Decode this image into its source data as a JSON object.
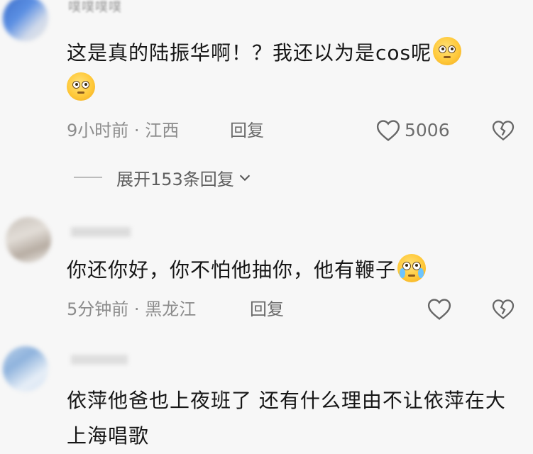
{
  "comments": [
    {
      "username": "噗噗噗噗",
      "text": "这是真的陆振华啊！？我还以为是cos呢",
      "time": "9小时前",
      "location": "江西",
      "reply_label": "回复",
      "like_count": "5006",
      "expand_label": "展开153条回复"
    },
    {
      "username": "",
      "text": "你还你好，你不怕他抽你，他有鞭子",
      "time": "5分钟前",
      "location": "黑龙江",
      "reply_label": "回复"
    },
    {
      "username": "",
      "text": "依萍他爸也上夜班了 还有什么理由不让依萍在大上海唱歌"
    }
  ],
  "separator": "·",
  "icons": {
    "like": "heart-outline-icon",
    "dislike": "broken-heart-icon",
    "expand": "chevron-down-icon",
    "emoji_rolling": "rolling-eyes-emoji",
    "emoji_pleading": "pleading-face-emoji"
  }
}
